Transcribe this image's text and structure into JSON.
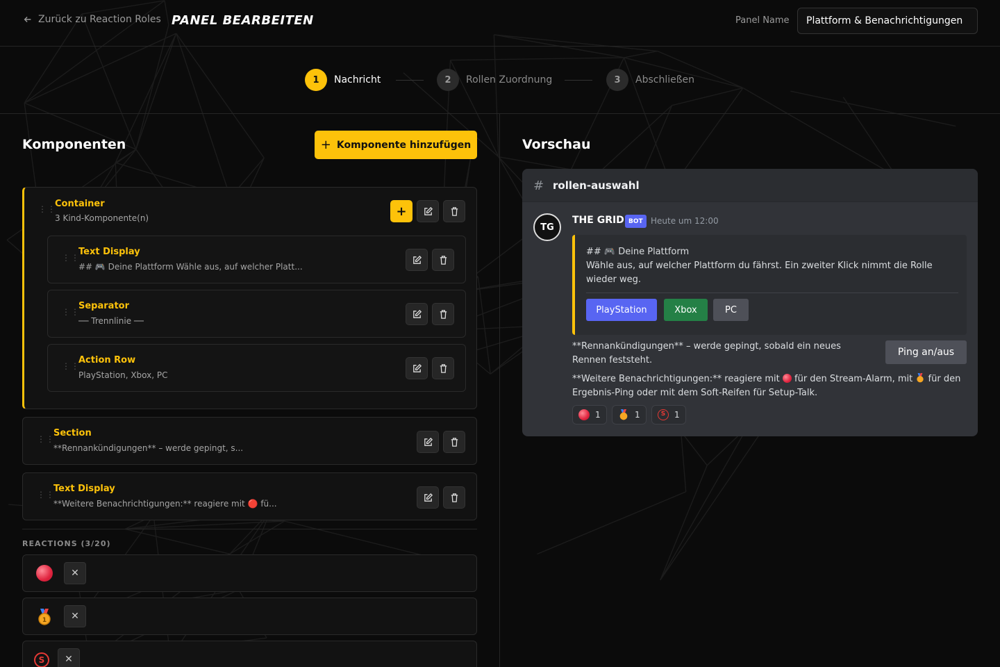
{
  "topbar": {
    "back_label": "Zurück zu Reaction Roles",
    "page_title": "PANEL BEARBEITEN",
    "panel_name_label": "Panel Name",
    "panel_name_value": "Plattform & Benachrichtigungen"
  },
  "steps": [
    {
      "number": "1",
      "label": "Nachricht",
      "active": true
    },
    {
      "number": "2",
      "label": "Rollen Zuordnung",
      "active": false
    },
    {
      "number": "3",
      "label": "Abschließen",
      "active": false
    }
  ],
  "components": {
    "heading": "Komponenten",
    "add_button": "Komponente hinzufügen",
    "items": [
      {
        "title": "Container",
        "subtitle": "3 Kind-Komponente(n)"
      },
      {
        "title": "Text Display",
        "subtitle": "## 🎮 Deine Plattform Wähle aus, auf welcher Platt..."
      },
      {
        "title": "Separator",
        "subtitle": "── Trennlinie ──"
      },
      {
        "title": "Action Row",
        "subtitle": "PlayStation, Xbox, PC"
      },
      {
        "title": "Section",
        "subtitle": "**Rennankündigungen** – werde gepingt, s..."
      },
      {
        "title": "Text Display",
        "subtitle": "**Weitere Benachrichtigungen:** reagiere mit 🔴 fü..."
      }
    ]
  },
  "reactions": {
    "label": "REACTIONS (3/20)",
    "items": [
      {
        "icon": "red-circle-icon"
      },
      {
        "icon": "medal-icon"
      },
      {
        "icon": "soft-tyre-icon"
      }
    ],
    "remove_symbol": "✕"
  },
  "preview": {
    "heading": "Vorschau",
    "channel": "rollen-auswahl",
    "author": "THE GRID",
    "bot_tag": "BOT",
    "timestamp": "Heute um 12:00",
    "avatar_text": "TG",
    "embed_heading": "## 🎮 Deine Plattform",
    "embed_text": "Wähle aus, auf welcher Plattform du fährst. Ein zweiter Klick nimmt die Rolle wieder weg.",
    "buttons": [
      {
        "label": "PlayStation",
        "color": "#5865f2"
      },
      {
        "label": "Xbox",
        "color": "#248046"
      },
      {
        "label": "PC",
        "color": "#4e5058"
      }
    ],
    "section_text": "**Rennankündigungen** – werde gepingt, sobald ein neues Rennen feststeht.",
    "section_button": "Ping an/aus",
    "more_text_1": "**Weitere Benachrichtigungen:** reagiere mit",
    "more_text_2": "für den Stream-Alarm, mit",
    "more_text_3": "für den Ergebnis-Ping oder mit dem Soft-Reifen für Setup-Talk.",
    "reactions": [
      {
        "icon": "red-circle-icon",
        "count": "1"
      },
      {
        "icon": "medal-icon",
        "count": "1"
      },
      {
        "icon": "soft-tyre-icon",
        "count": "1"
      }
    ]
  },
  "colors": {
    "accent": "#fdc20a",
    "background": "#0b0b0b",
    "discord_bg": "#313338"
  }
}
